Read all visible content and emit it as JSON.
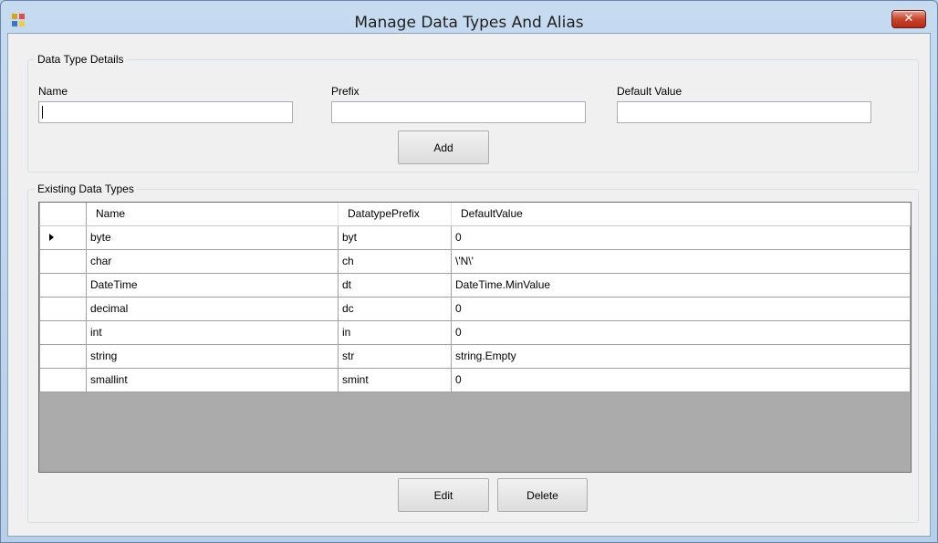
{
  "window": {
    "title": "Manage Data Types And Alias",
    "close_label": "✕",
    "app_icon": "app-icon"
  },
  "details_group": {
    "label": "Data Type Details",
    "name_label": "Name",
    "name_value": "",
    "prefix_label": "Prefix",
    "prefix_value": "",
    "default_label": "Default Value",
    "default_value": "",
    "add_label": "Add"
  },
  "existing_group": {
    "label": "Existing Data Types",
    "columns": [
      "Name",
      "DatatypePrefix",
      "DefaultValue"
    ],
    "rows": [
      {
        "name": "byte",
        "prefix": "byt",
        "default": "0"
      },
      {
        "name": "char",
        "prefix": "ch",
        "default": "\\'N\\'"
      },
      {
        "name": "DateTime",
        "prefix": "dt",
        "default": "DateTime.MinValue"
      },
      {
        "name": "decimal",
        "prefix": "dc",
        "default": "0"
      },
      {
        "name": "int",
        "prefix": "in",
        "default": "0"
      },
      {
        "name": "string",
        "prefix": "str",
        "default": "string.Empty"
      },
      {
        "name": "smallint",
        "prefix": "smint",
        "default": "0"
      }
    ],
    "current_row": 0,
    "edit_label": "Edit",
    "delete_label": "Delete"
  },
  "colors": {
    "title_bar": "#c6dbf0",
    "client_bg": "#f0f0f0",
    "grid_empty": "#ababab",
    "close_red": "#c7442d"
  }
}
